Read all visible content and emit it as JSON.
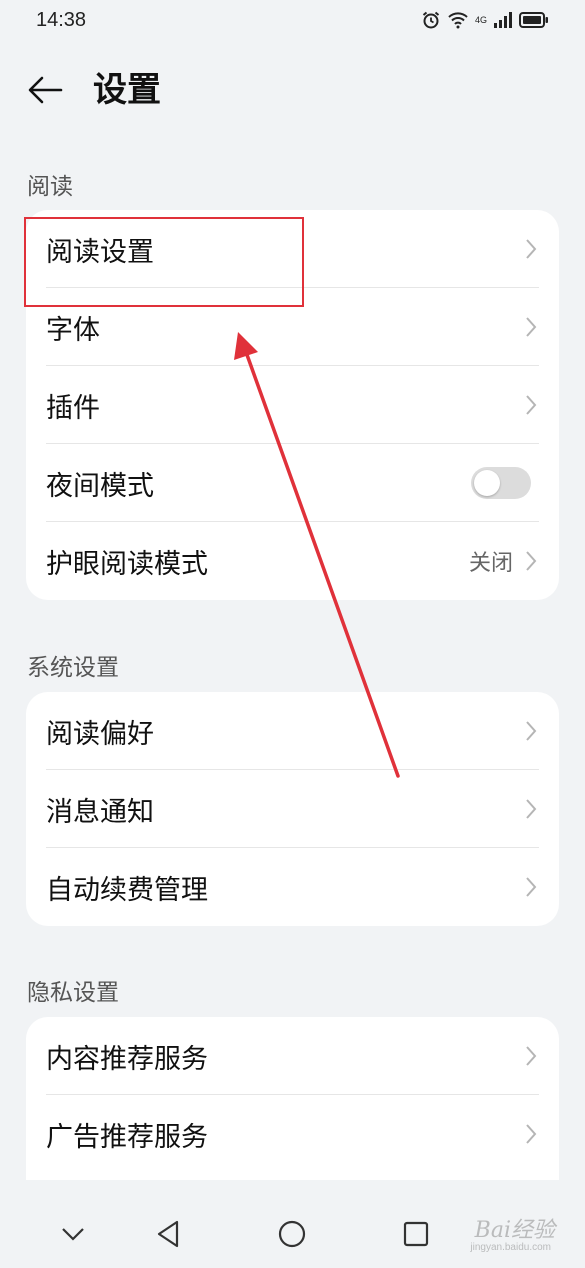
{
  "status_bar": {
    "time": "14:38",
    "network": "4G",
    "icons": [
      "alarm-icon",
      "wifi-icon",
      "signal-icon",
      "battery-icon"
    ]
  },
  "header": {
    "title": "设置",
    "back_icon": "back-arrow-icon"
  },
  "sections": [
    {
      "title": "阅读",
      "items": [
        {
          "label": "阅读设置",
          "control": "chevron"
        },
        {
          "label": "字体",
          "control": "chevron"
        },
        {
          "label": "插件",
          "control": "chevron"
        },
        {
          "label": "夜间模式",
          "control": "toggle",
          "on": false
        },
        {
          "label": "护眼阅读模式",
          "control": "chevron",
          "value": "关闭"
        }
      ]
    },
    {
      "title": "系统设置",
      "items": [
        {
          "label": "阅读偏好",
          "control": "chevron"
        },
        {
          "label": "消息通知",
          "control": "chevron"
        },
        {
          "label": "自动续费管理",
          "control": "chevron"
        }
      ]
    },
    {
      "title": "隐私设置",
      "items": [
        {
          "label": "内容推荐服务",
          "control": "chevron"
        },
        {
          "label": "广告推荐服务",
          "control": "chevron"
        }
      ]
    }
  ],
  "nav_bar": {
    "icons": [
      "collapse-icon",
      "back-triangle-icon",
      "home-circle-icon",
      "recents-square-icon"
    ]
  },
  "watermark": {
    "text": "Bai经验",
    "sub": "jingyan.baidu.com"
  },
  "colors": {
    "background": "#f1f3f5",
    "card": "#ffffff",
    "annotation": "#e0313a"
  }
}
